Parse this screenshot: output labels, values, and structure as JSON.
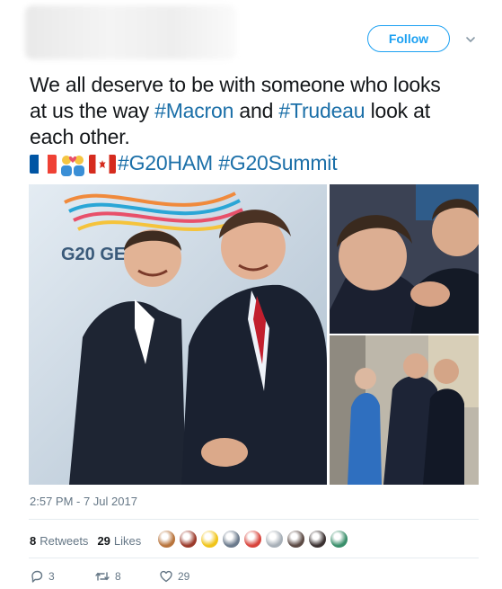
{
  "header": {
    "follow_label": "Follow",
    "caret_icon": "chevron-down-icon"
  },
  "tweet": {
    "line1": "We all deserve to be with someone who looks",
    "line2_pre": "at us the way ",
    "tag_macron": "#Macron",
    "line2_mid": " and ",
    "tag_trudeau": "#Trudeau",
    "line2_post": " look at",
    "line3": "each other.",
    "tag_g20ham": "#G20HAM",
    "tag_g20summit": "#G20Summit",
    "emoji": [
      "flag-france",
      "couple-with-heart",
      "flag-canada"
    ]
  },
  "media": {
    "backdrop_text": "G20 GE    NY",
    "ribbon_colors": [
      "#f08a3c",
      "#2aa6d6",
      "#e8506a",
      "#f5c33b"
    ]
  },
  "meta": {
    "timestamp": "2:57 PM - 7 Jul 2017"
  },
  "stats": {
    "retweets_count": "8",
    "retweets_label": "Retweets",
    "likes_count": "29",
    "likes_label": "Likes",
    "avatar_colors": [
      "#b8743c",
      "#9b3a2b",
      "#f0c419",
      "#6b7a8c",
      "#d8443c",
      "#a8b0b8",
      "#5c4a44",
      "#3a3030",
      "#3a8f6b"
    ]
  },
  "actions": {
    "reply_count": "3",
    "retweet_count": "8",
    "like_count": "29"
  },
  "colors": {
    "accent": "#1da1f2",
    "hashtag": "#1b6fa8",
    "muted": "#657786"
  }
}
